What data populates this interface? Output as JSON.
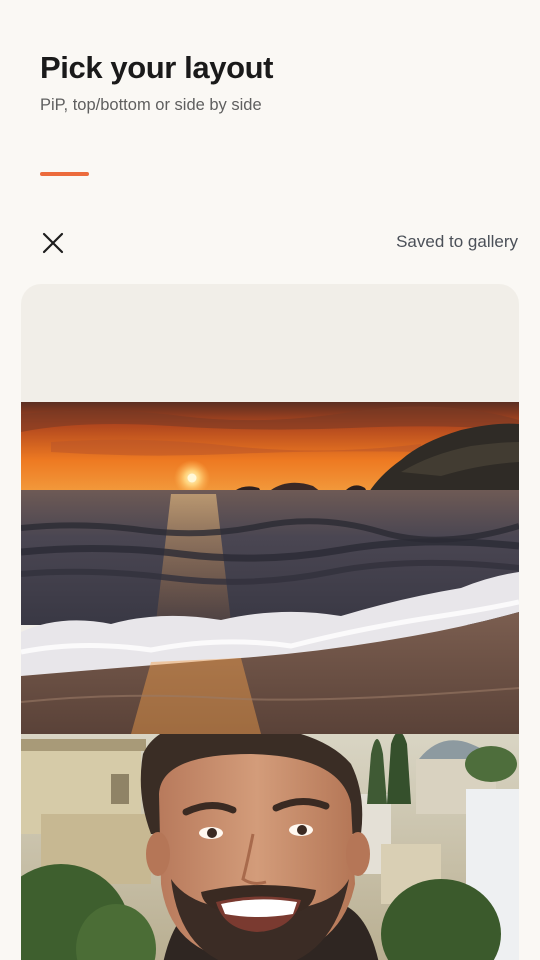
{
  "header": {
    "title": "Pick your layout",
    "subtitle": "PiP, top/bottom or side by side"
  },
  "progress": {
    "step_fraction": 0.25,
    "accent_color": "#ec6b3c"
  },
  "toolbar": {
    "close_icon": "close-icon",
    "status_text": "Saved to gallery"
  },
  "preview": {
    "layout": "top/bottom",
    "top_photo": "sunset-beach-photo",
    "bottom_photo": "smiling-man-selfie-photo"
  }
}
